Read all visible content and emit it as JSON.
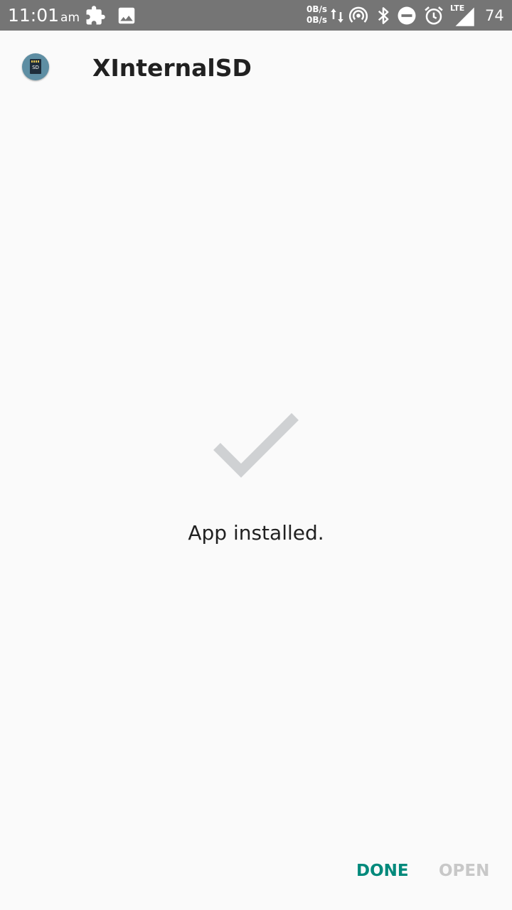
{
  "status_bar": {
    "time": "11:01",
    "ampm": "am",
    "net_up": "0B/s",
    "net_down": "0B/s",
    "network_type": "LTE",
    "battery": "74",
    "icons": [
      "puzzle-icon",
      "image-icon",
      "data-arrows-icon",
      "hotspot-icon",
      "bluetooth-icon",
      "do-not-disturb-icon",
      "alarm-icon",
      "signal-icon"
    ]
  },
  "header": {
    "app_icon_text": "SD",
    "app_name": "XInternalSD"
  },
  "main": {
    "check_color": "#cfd1d3",
    "message": "App installed."
  },
  "actions": {
    "done_label": "DONE",
    "open_label": "OPEN",
    "accent_color": "#00897b",
    "disabled_color": "#c8c8c8"
  }
}
